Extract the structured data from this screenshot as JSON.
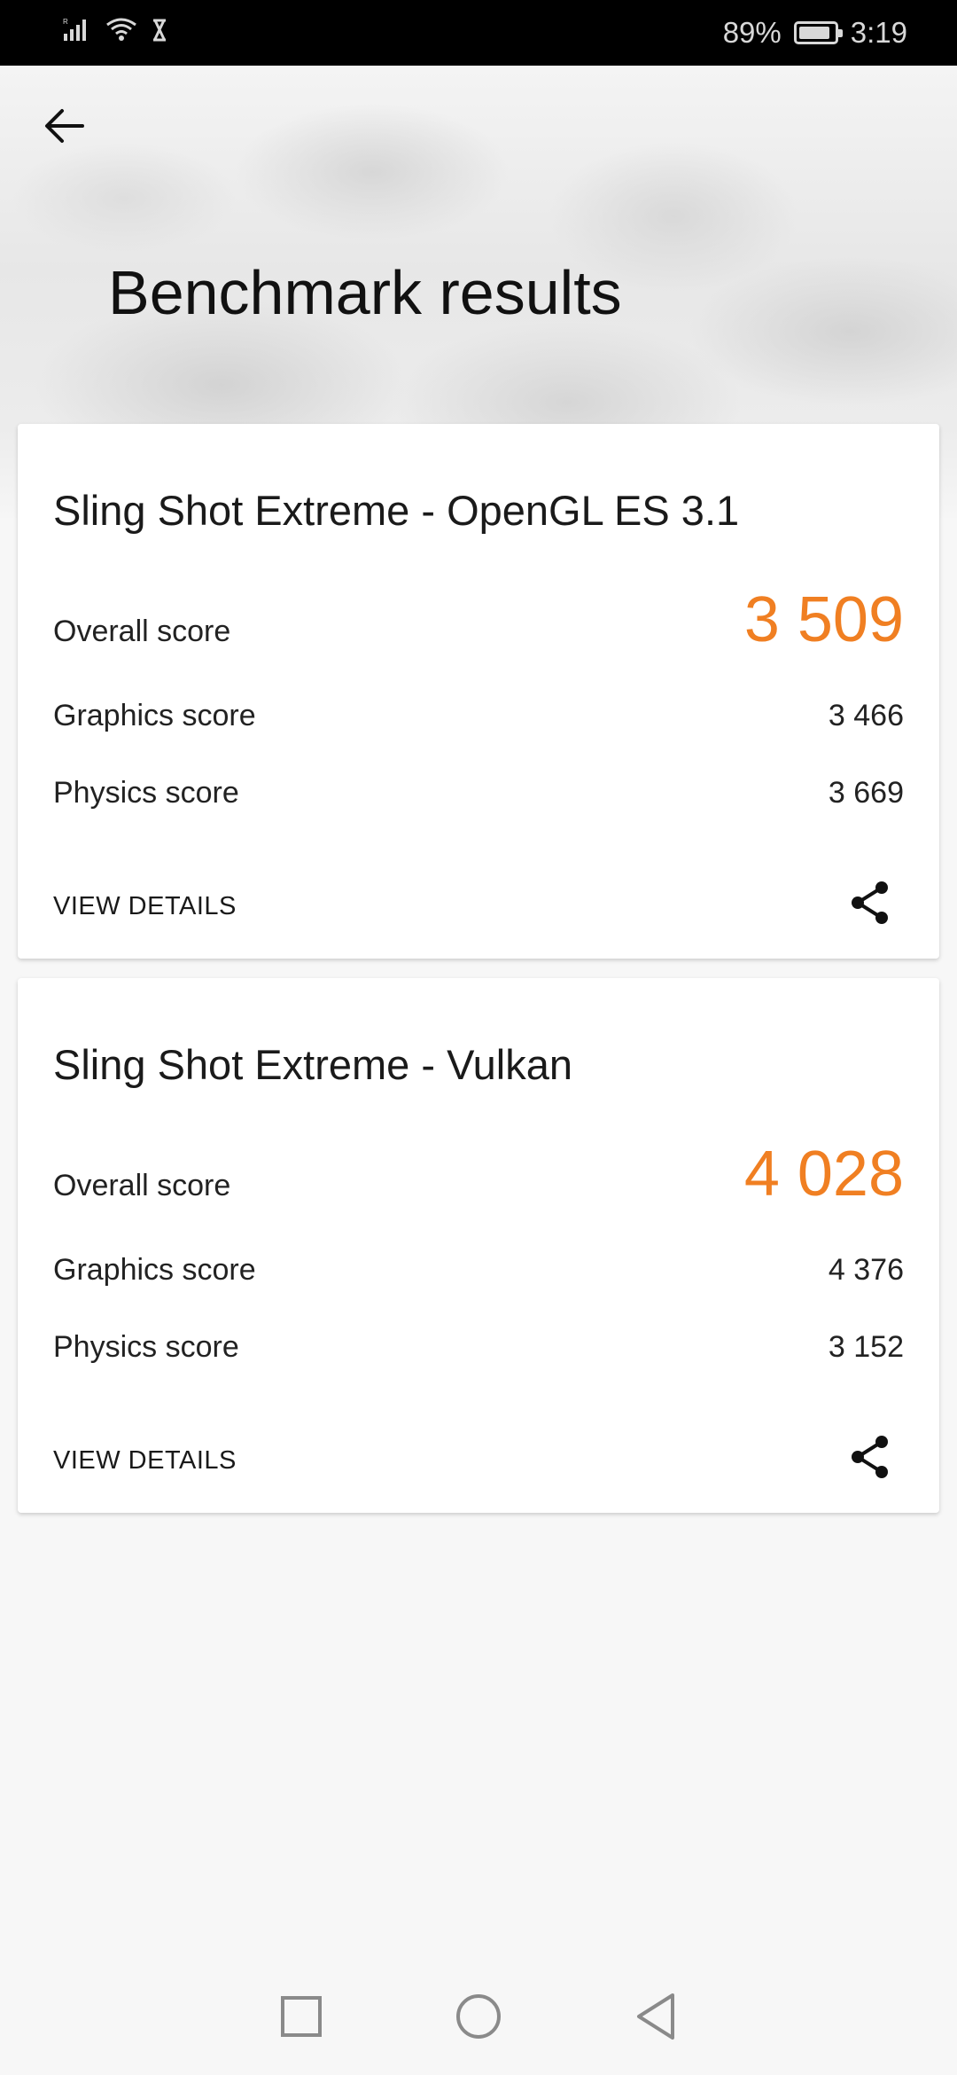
{
  "status_bar": {
    "battery_percent": "89%",
    "time": "3:19",
    "battery_level": 0.89,
    "icons": [
      "signal-icon",
      "wifi-icon",
      "hourglass-icon",
      "battery-icon"
    ]
  },
  "header": {
    "title": "Benchmark results",
    "back_icon": "arrow-left-icon"
  },
  "results": [
    {
      "title": "Sling Shot Extreme - OpenGL ES 3.1",
      "overall_label": "Overall score",
      "overall_value": "3 509",
      "graphics_label": "Graphics score",
      "graphics_value": "3 466",
      "physics_label": "Physics score",
      "physics_value": "3 669",
      "details_label": "VIEW DETAILS",
      "share_icon": "share-icon"
    },
    {
      "title": "Sling Shot Extreme - Vulkan",
      "overall_label": "Overall score",
      "overall_value": "4 028",
      "graphics_label": "Graphics score",
      "graphics_value": "4 376",
      "physics_label": "Physics score",
      "physics_value": "3 152",
      "details_label": "VIEW DETAILS",
      "share_icon": "share-icon"
    }
  ],
  "colors": {
    "accent": "#f07f22",
    "status_bar": "#000000",
    "background": "#f7f7f7"
  },
  "nav_bar": {
    "icons": [
      "recents-square-icon",
      "home-circle-icon",
      "back-triangle-icon"
    ]
  }
}
